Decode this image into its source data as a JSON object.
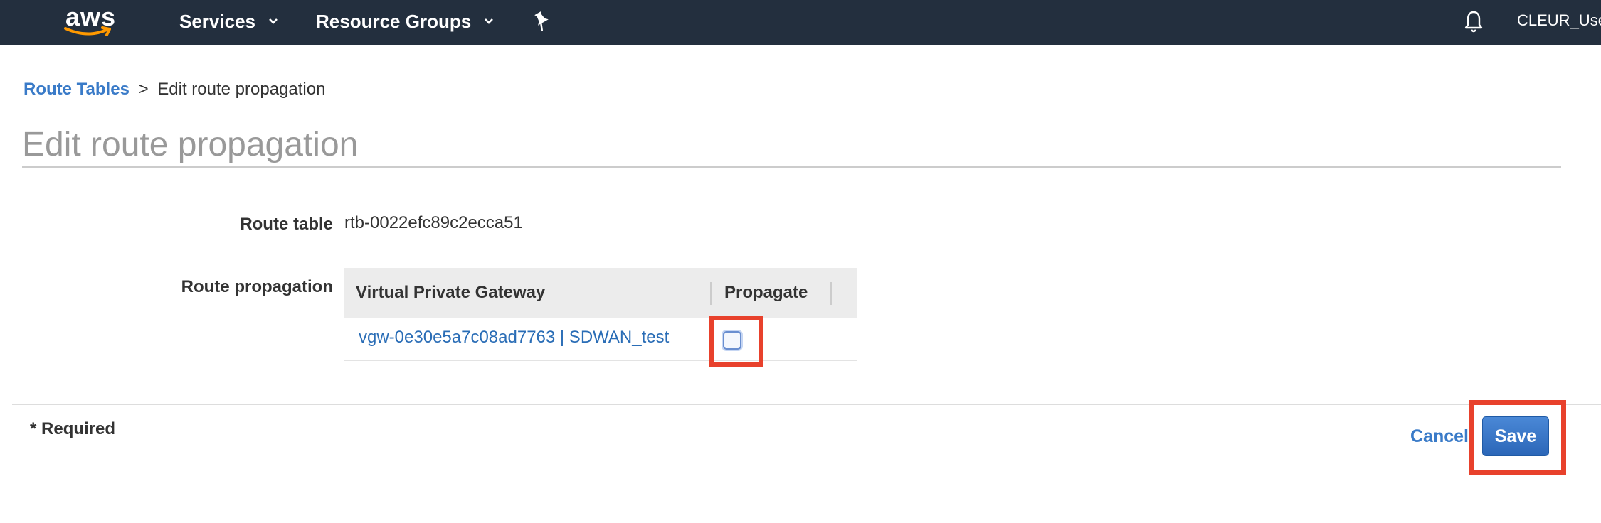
{
  "topnav": {
    "logo_text": "aws",
    "services_label": "Services",
    "resource_groups_label": "Resource Groups",
    "user_name": "CLEUR_User",
    "bg_color": "#232f3e",
    "logo_smile_color": "#ff9900"
  },
  "breadcrumb": {
    "link_label": "Route Tables",
    "separator": ">",
    "current": "Edit route propagation"
  },
  "page": {
    "title": "Edit route propagation"
  },
  "form": {
    "route_table_label": "Route table",
    "route_table_value": "rtb-0022efc89c2ecca51",
    "route_propagation_label": "Route propagation"
  },
  "table": {
    "columns": [
      "Virtual Private Gateway",
      "Propagate"
    ],
    "rows": [
      {
        "gateway": "vgw-0e30e5a7c08ad7763 | SDWAN_test",
        "propagate": false
      }
    ]
  },
  "footer": {
    "required_text": "* Required",
    "cancel_label": "Cancel",
    "save_label": "Save"
  },
  "colors": {
    "link": "#3a7bc8",
    "primary_button": "#2b66b8",
    "highlight": "#e8412c"
  }
}
